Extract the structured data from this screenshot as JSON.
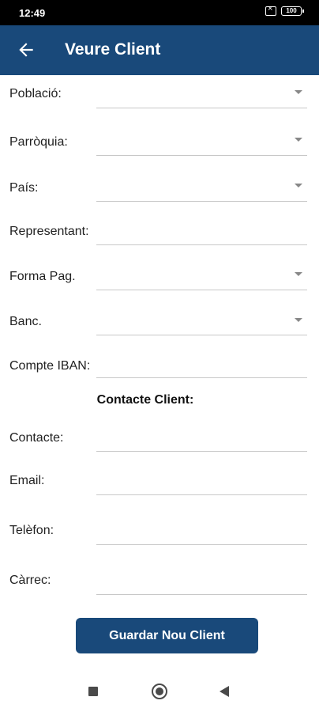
{
  "status_bar": {
    "time": "12:49",
    "battery": "100"
  },
  "app_bar": {
    "title": "Veure Client",
    "back_icon": "arrow-left-icon"
  },
  "form": {
    "fields": [
      {
        "label": "Població:",
        "type": "dropdown",
        "value": ""
      },
      {
        "label": "Parròquia:",
        "type": "dropdown",
        "value": ""
      },
      {
        "label": "País:",
        "type": "dropdown",
        "value": ""
      },
      {
        "label": "Representant:",
        "type": "text",
        "value": ""
      },
      {
        "label": "Forma Pag.",
        "type": "dropdown",
        "value": ""
      },
      {
        "label": "Banc.",
        "type": "dropdown",
        "value": ""
      },
      {
        "label": "Compte IBAN:",
        "type": "text",
        "value": ""
      }
    ],
    "contact_heading": "Contacte Client:",
    "contact_fields": [
      {
        "label": "Contacte:",
        "type": "text",
        "value": ""
      },
      {
        "label": "Email:",
        "type": "text",
        "value": ""
      },
      {
        "label": "Telèfon:",
        "type": "text",
        "value": ""
      },
      {
        "label": "Càrrec:",
        "type": "text",
        "value": ""
      }
    ]
  },
  "save_button": {
    "label": "Guardar Nou Client"
  },
  "colors": {
    "primary": "#19497a",
    "status_bar": "#000000",
    "underline": "#c8c8c8"
  },
  "nav_bar": {
    "icons": [
      "recents-square-icon",
      "home-circle-icon",
      "back-triangle-icon"
    ]
  }
}
